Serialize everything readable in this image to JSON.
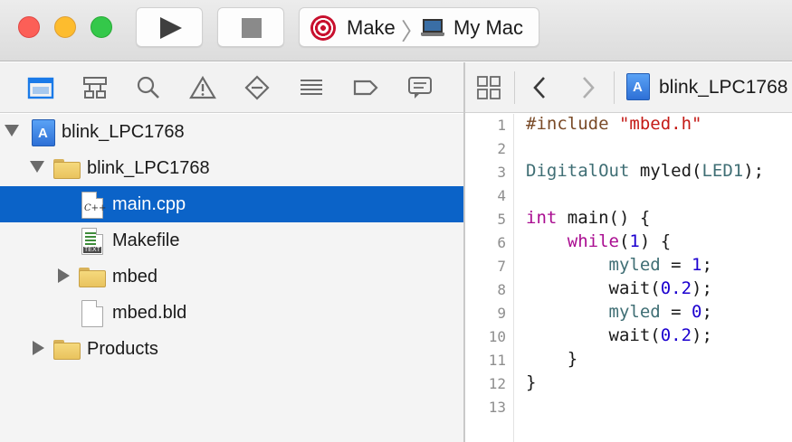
{
  "toolbar": {
    "scheme": {
      "target": "Make",
      "destination": "My Mac"
    }
  },
  "navigator": {
    "rows": [
      {
        "label": "blink_LPC1768"
      },
      {
        "label": "blink_LPC1768"
      },
      {
        "label": "main.cpp"
      },
      {
        "label": "Makefile"
      },
      {
        "label": "mbed"
      },
      {
        "label": "mbed.bld"
      },
      {
        "label": "Products"
      }
    ]
  },
  "editor": {
    "jumpbar_title": "blink_LPC1768",
    "line_numbers": [
      "1",
      "2",
      "3",
      "4",
      "5",
      "6",
      "7",
      "8",
      "9",
      "10",
      "11",
      "12",
      "13"
    ]
  },
  "colors": {
    "selection": "#0b63c8",
    "keyword": "#aa0d91",
    "string": "#c41a16",
    "number": "#1c00cf",
    "preprocessor": "#7a4b28",
    "identifier": "#3f6e74"
  }
}
